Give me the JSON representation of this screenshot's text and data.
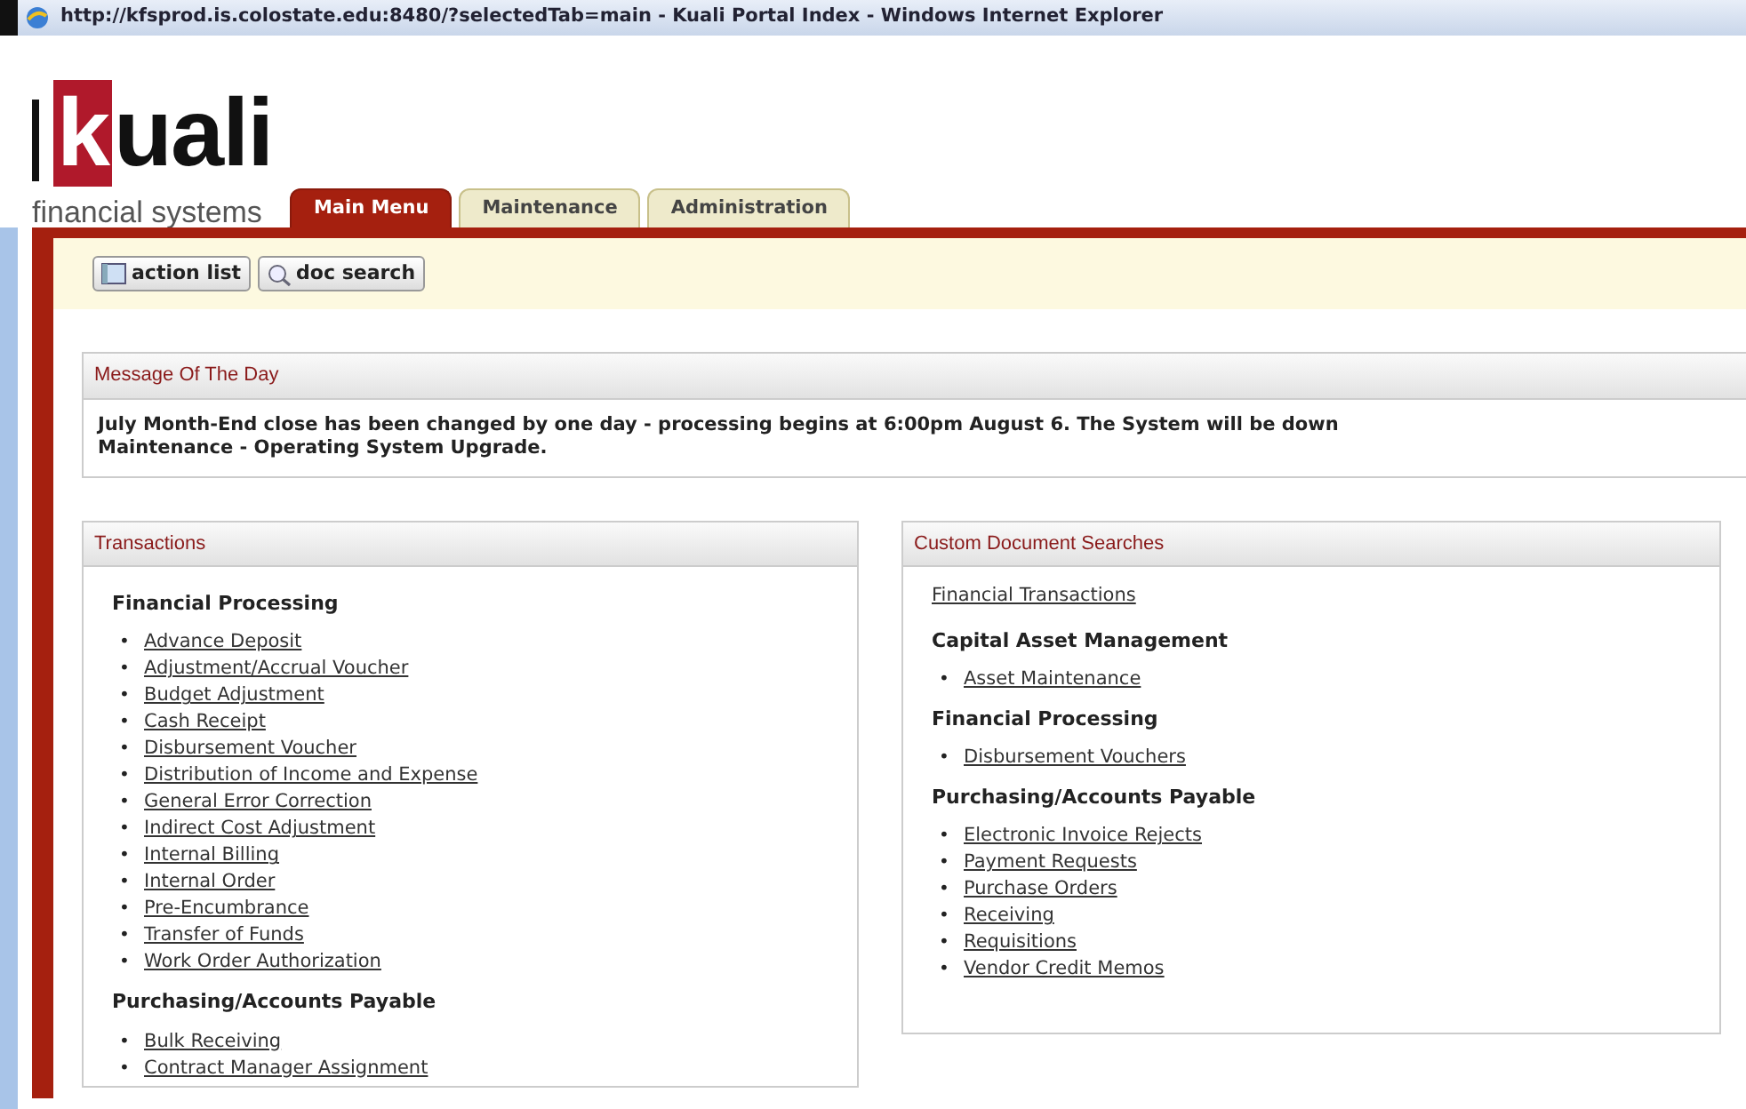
{
  "window": {
    "title": "http://kfsprod.is.colostate.edu:8480/?selectedTab=main - Kuali Portal Index - Windows Internet Explorer"
  },
  "logo": {
    "wordmark": "kuali",
    "subtitle": "financial systems"
  },
  "tabs": [
    {
      "label": "Main Menu",
      "selected": true
    },
    {
      "label": "Maintenance",
      "selected": false
    },
    {
      "label": "Administration",
      "selected": false
    }
  ],
  "toolbar": [
    {
      "label": "action list",
      "kind": "list"
    },
    {
      "label": "doc search",
      "kind": "search"
    }
  ],
  "message": {
    "title": "Message Of The Day",
    "text": "July Month-End close has been changed by one day - processing begins at 6:00pm August 6. The System will be down",
    "text_line_2": "Maintenance - Operating System Upgrade."
  },
  "panels": [
    {
      "title": "Transactions",
      "blocks": [
        {
          "kind": "heading",
          "text": "Financial Processing"
        },
        {
          "kind": "list",
          "items": [
            {
              "marker": "•",
              "label": "Advance Deposit"
            },
            {
              "marker": "•",
              "label": "Adjustment/Accrual Voucher"
            },
            {
              "marker": "•",
              "label": "Budget Adjustment"
            },
            {
              "marker": "•",
              "label": "Cash Receipt"
            },
            {
              "marker": "•",
              "label": "Disbursement Voucher"
            },
            {
              "marker": "•",
              "label": "Distribution of Income and Expense"
            },
            {
              "marker": "•",
              "label": "General Error Correction"
            },
            {
              "marker": "•",
              "label": "Indirect Cost Adjustment"
            },
            {
              "marker": "•",
              "label": "Internal Billing"
            },
            {
              "marker": "•",
              "label": "Internal Order"
            },
            {
              "marker": "•",
              "label": "Pre-Encumbrance"
            },
            {
              "marker": "•",
              "label": "Transfer of Funds"
            },
            {
              "marker": "•",
              "label": "Work Order Authorization"
            }
          ]
        },
        {
          "kind": "heading",
          "text": "Purchasing/Accounts Payable"
        },
        {
          "kind": "list",
          "items": [
            {
              "marker": "•",
              "label": "Bulk Receiving"
            },
            {
              "marker": "•",
              "label": "Contract Manager Assignment"
            }
          ]
        }
      ]
    },
    {
      "title": "Custom Document Searches",
      "blocks": [
        {
          "kind": "link",
          "text": "Financial Transactions"
        },
        {
          "kind": "heading",
          "text": "Capital Asset Management"
        },
        {
          "kind": "list",
          "items": [
            {
              "marker": "•",
              "label": "Asset Maintenance"
            }
          ]
        },
        {
          "kind": "heading",
          "text": "Financial Processing"
        },
        {
          "kind": "list",
          "items": [
            {
              "marker": "•",
              "label": "Disbursement Vouchers"
            }
          ]
        },
        {
          "kind": "heading",
          "text": "Purchasing/Accounts Payable"
        },
        {
          "kind": "list",
          "items": [
            {
              "marker": "•",
              "label": "Electronic Invoice Rejects"
            },
            {
              "marker": "•",
              "label": "Payment Requests"
            },
            {
              "marker": "•",
              "label": "Purchase Orders"
            },
            {
              "marker": "•",
              "label": "Receiving"
            },
            {
              "marker": "•",
              "label": "Requisitions"
            },
            {
              "marker": "•",
              "label": "Vendor Credit Memos"
            }
          ]
        }
      ]
    }
  ]
}
